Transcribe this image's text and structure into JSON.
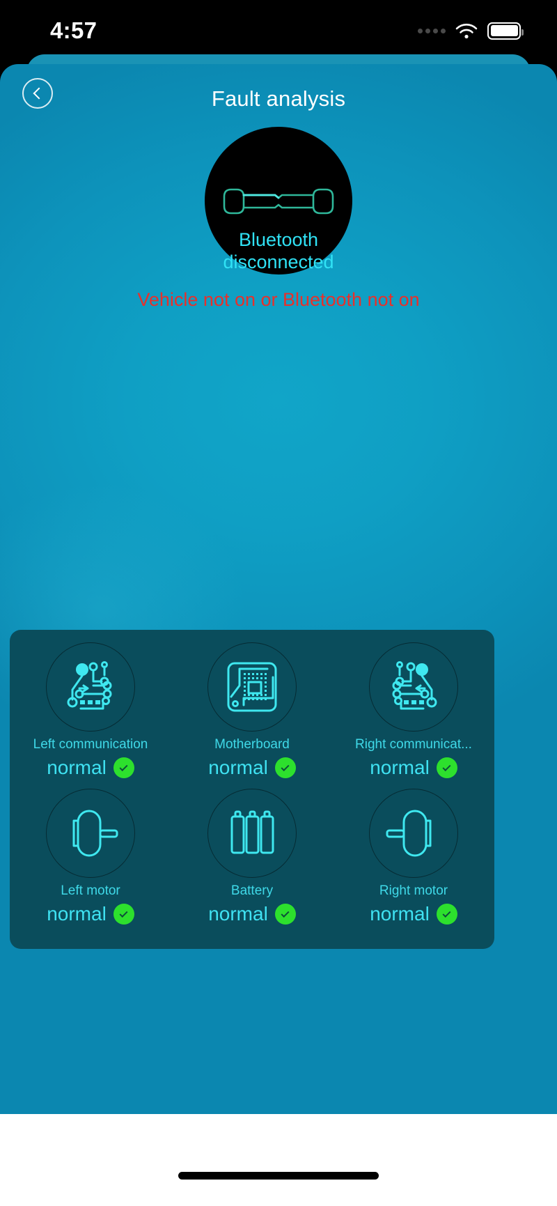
{
  "status_bar": {
    "time": "4:57",
    "signal_icon": "signal-dots-icon",
    "wifi_icon": "wifi-icon",
    "battery_icon": "battery-full-icon"
  },
  "nav": {
    "back_icon": "chevron-left-icon",
    "title": "Fault analysis"
  },
  "hero": {
    "device_icon": "scooter-handlebar-icon",
    "connection_state": "Bluetooth\ndisconnected",
    "connection_state_line1": "Bluetooth",
    "connection_state_line2": "disconnected",
    "warning": "Vehicle not on or Bluetooth not on",
    "warning_color": "#e8302b",
    "state_color": "#30e2f5"
  },
  "diagnostics": {
    "panel_bg": "#0a4d5c",
    "ok_badge_color": "#2de02d",
    "rows": [
      {
        "cells": [
          {
            "icon": "left-communication-circuit-icon",
            "label": "Left communication",
            "status": "normal",
            "badge": "check-icon"
          },
          {
            "icon": "motherboard-chip-icon",
            "label": "Motherboard",
            "status": "normal",
            "badge": "check-icon"
          },
          {
            "icon": "right-communication-circuit-icon",
            "label": "Right communicat...",
            "status": "normal",
            "badge": "check-icon"
          }
        ]
      },
      {
        "cells": [
          {
            "icon": "left-motor-icon",
            "label": "Left motor",
            "status": "normal",
            "badge": "check-icon"
          },
          {
            "icon": "battery-cells-icon",
            "label": "Battery",
            "status": "normal",
            "badge": "check-icon"
          },
          {
            "icon": "right-motor-icon",
            "label": "Right motor",
            "status": "normal",
            "badge": "check-icon"
          }
        ]
      }
    ]
  },
  "home_indicator": {
    "icon": "home-bar-icon"
  }
}
